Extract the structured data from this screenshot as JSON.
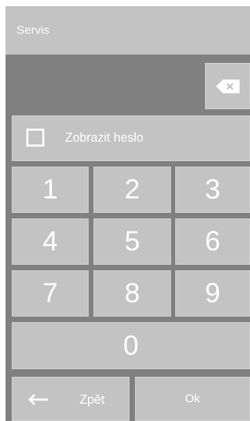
{
  "header": {
    "title": "Servis"
  },
  "toggle": {
    "label": "Zobrazit heslo",
    "checked": false
  },
  "keypad": {
    "keys": [
      "1",
      "2",
      "3",
      "4",
      "5",
      "6",
      "7",
      "8",
      "9",
      "0"
    ]
  },
  "actions": {
    "back_label": "Zpět",
    "ok_label": "Ok"
  },
  "colors": {
    "header_bg": "#c3c3c3",
    "panel_bg": "#808080",
    "button_bg": "#c3c3c3",
    "text": "#ffffff"
  }
}
